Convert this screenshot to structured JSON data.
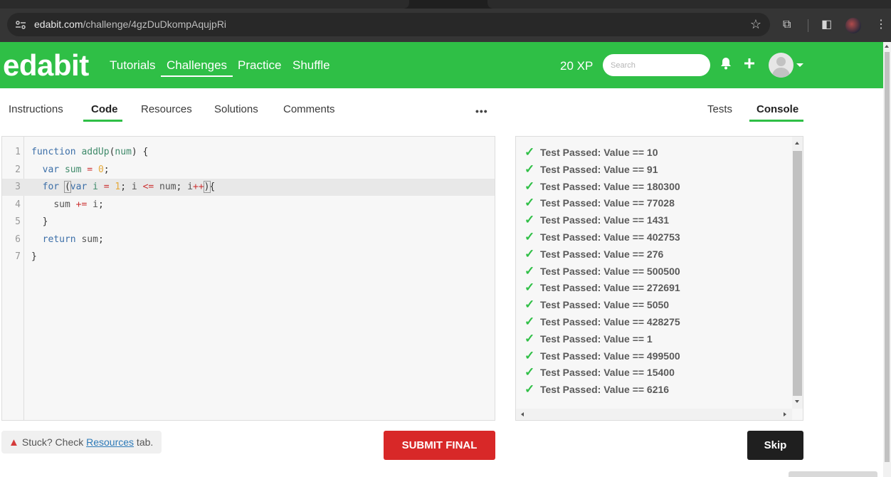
{
  "browser": {
    "url_host": "edabit.com",
    "url_path": "/challenge/4gzDuDkompAqujpRi"
  },
  "header": {
    "logo": "edabit",
    "nav": [
      "Tutorials",
      "Challenges",
      "Practice",
      "Shuffle"
    ],
    "active_nav": "Challenges",
    "xp": "20 XP",
    "search_placeholder": "Search"
  },
  "left_tabs": [
    "Instructions",
    "Code",
    "Resources",
    "Solutions",
    "Comments"
  ],
  "left_active_tab": "Code",
  "right_tabs": [
    "Tests",
    "Console"
  ],
  "right_active_tab": "Console",
  "more_menu": "•••",
  "code": {
    "line_numbers": [
      "1",
      "2",
      "3",
      "4",
      "5",
      "6",
      "7"
    ],
    "active_line": 3
  },
  "console": {
    "tests": [
      "Test Passed: Value == 10",
      "Test Passed: Value == 91",
      "Test Passed: Value == 180300",
      "Test Passed: Value == 77028",
      "Test Passed: Value == 1431",
      "Test Passed: Value == 402753",
      "Test Passed: Value == 276",
      "Test Passed: Value == 500500",
      "Test Passed: Value == 272691",
      "Test Passed: Value == 5050",
      "Test Passed: Value == 428275",
      "Test Passed: Value == 1",
      "Test Passed: Value == 499500",
      "Test Passed: Value == 15400",
      "Test Passed: Value == 6216"
    ]
  },
  "footer": {
    "stuck_prefix": "Stuck? Check ",
    "stuck_link": "Resources",
    "stuck_suffix": " tab.",
    "submit": "SUBMIT FINAL",
    "skip": "Skip"
  },
  "colors": {
    "brand_green": "#2fbf46",
    "submit_red": "#d82828",
    "skip_dark": "#1f1f1f"
  }
}
